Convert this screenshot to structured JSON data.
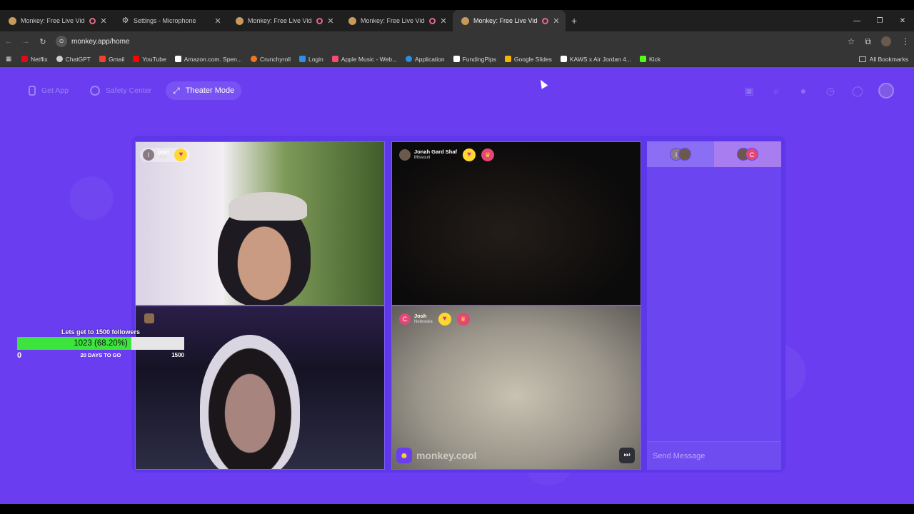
{
  "browser": {
    "tabs": [
      {
        "title": "Monkey: Free Live Video Ch",
        "recording": true
      },
      {
        "title": "Settings - Microphone",
        "recording": false
      },
      {
        "title": "Monkey: Free Live Video Ch",
        "recording": true
      },
      {
        "title": "Monkey: Free Live Video Ch",
        "recording": true
      },
      {
        "title": "Monkey: Free Live Video Ch",
        "recording": true
      }
    ],
    "url": "monkey.app/home",
    "bookmarks": [
      {
        "label": "Netflix",
        "color": "#e50914"
      },
      {
        "label": "ChatGPT",
        "color": "#cfcfcf"
      },
      {
        "label": "Gmail",
        "color": "#ea4335"
      },
      {
        "label": "YouTube",
        "color": "#ff0000"
      },
      {
        "label": "Amazon.com. Spen...",
        "color": "#ffffff"
      },
      {
        "label": "Crunchyroll",
        "color": "#f47521"
      },
      {
        "label": "Login",
        "color": "#2f8ee6"
      },
      {
        "label": "Apple Music - Web...",
        "color": "#fa4a6d"
      },
      {
        "label": "Application",
        "color": "#2b8fe0"
      },
      {
        "label": "FundingPips",
        "color": "#ffffff"
      },
      {
        "label": "Google Slides",
        "color": "#f4b400"
      },
      {
        "label": "KAWS x Air Jordan 4...",
        "color": "#ffffff"
      },
      {
        "label": "Kick",
        "color": "#53fc18"
      }
    ],
    "all_bookmarks": "All Bookmarks"
  },
  "nav": {
    "get_app": "Get App",
    "safety_center": "Safety Center",
    "theater_mode": "Theater Mode"
  },
  "videos": {
    "v1": {
      "initial": "I",
      "name": "papi",
      "location": "Utah"
    },
    "v2": {
      "name": "Jonah Gard Shaf",
      "location": "Missouri"
    },
    "v4": {
      "initial": "C",
      "name": "Josh",
      "location": "Nebraska"
    },
    "watermark": "monkey.cool"
  },
  "chat": {
    "tab1_initial": "I",
    "tab2_initial": "C",
    "placeholder": "Send Message"
  },
  "goal": {
    "title": "Lets get to 1500 followers",
    "current_text": "1023 (68.20%)",
    "progress_fraction": 0.682,
    "start": "0",
    "days_left": "20 DAYS TO GO",
    "target": "1500"
  },
  "colors": {
    "page_bg": "#6a3ef0",
    "progress_fill": "#3ee43e",
    "heart_badge": "#ffd830",
    "pink_avatar": "#e34778"
  },
  "icons": [
    "netflix-icon",
    "search-icon",
    "history-icon",
    "chat-icon",
    "hanger-icon",
    "theater-icon",
    "shield-icon",
    "phone-icon"
  ]
}
